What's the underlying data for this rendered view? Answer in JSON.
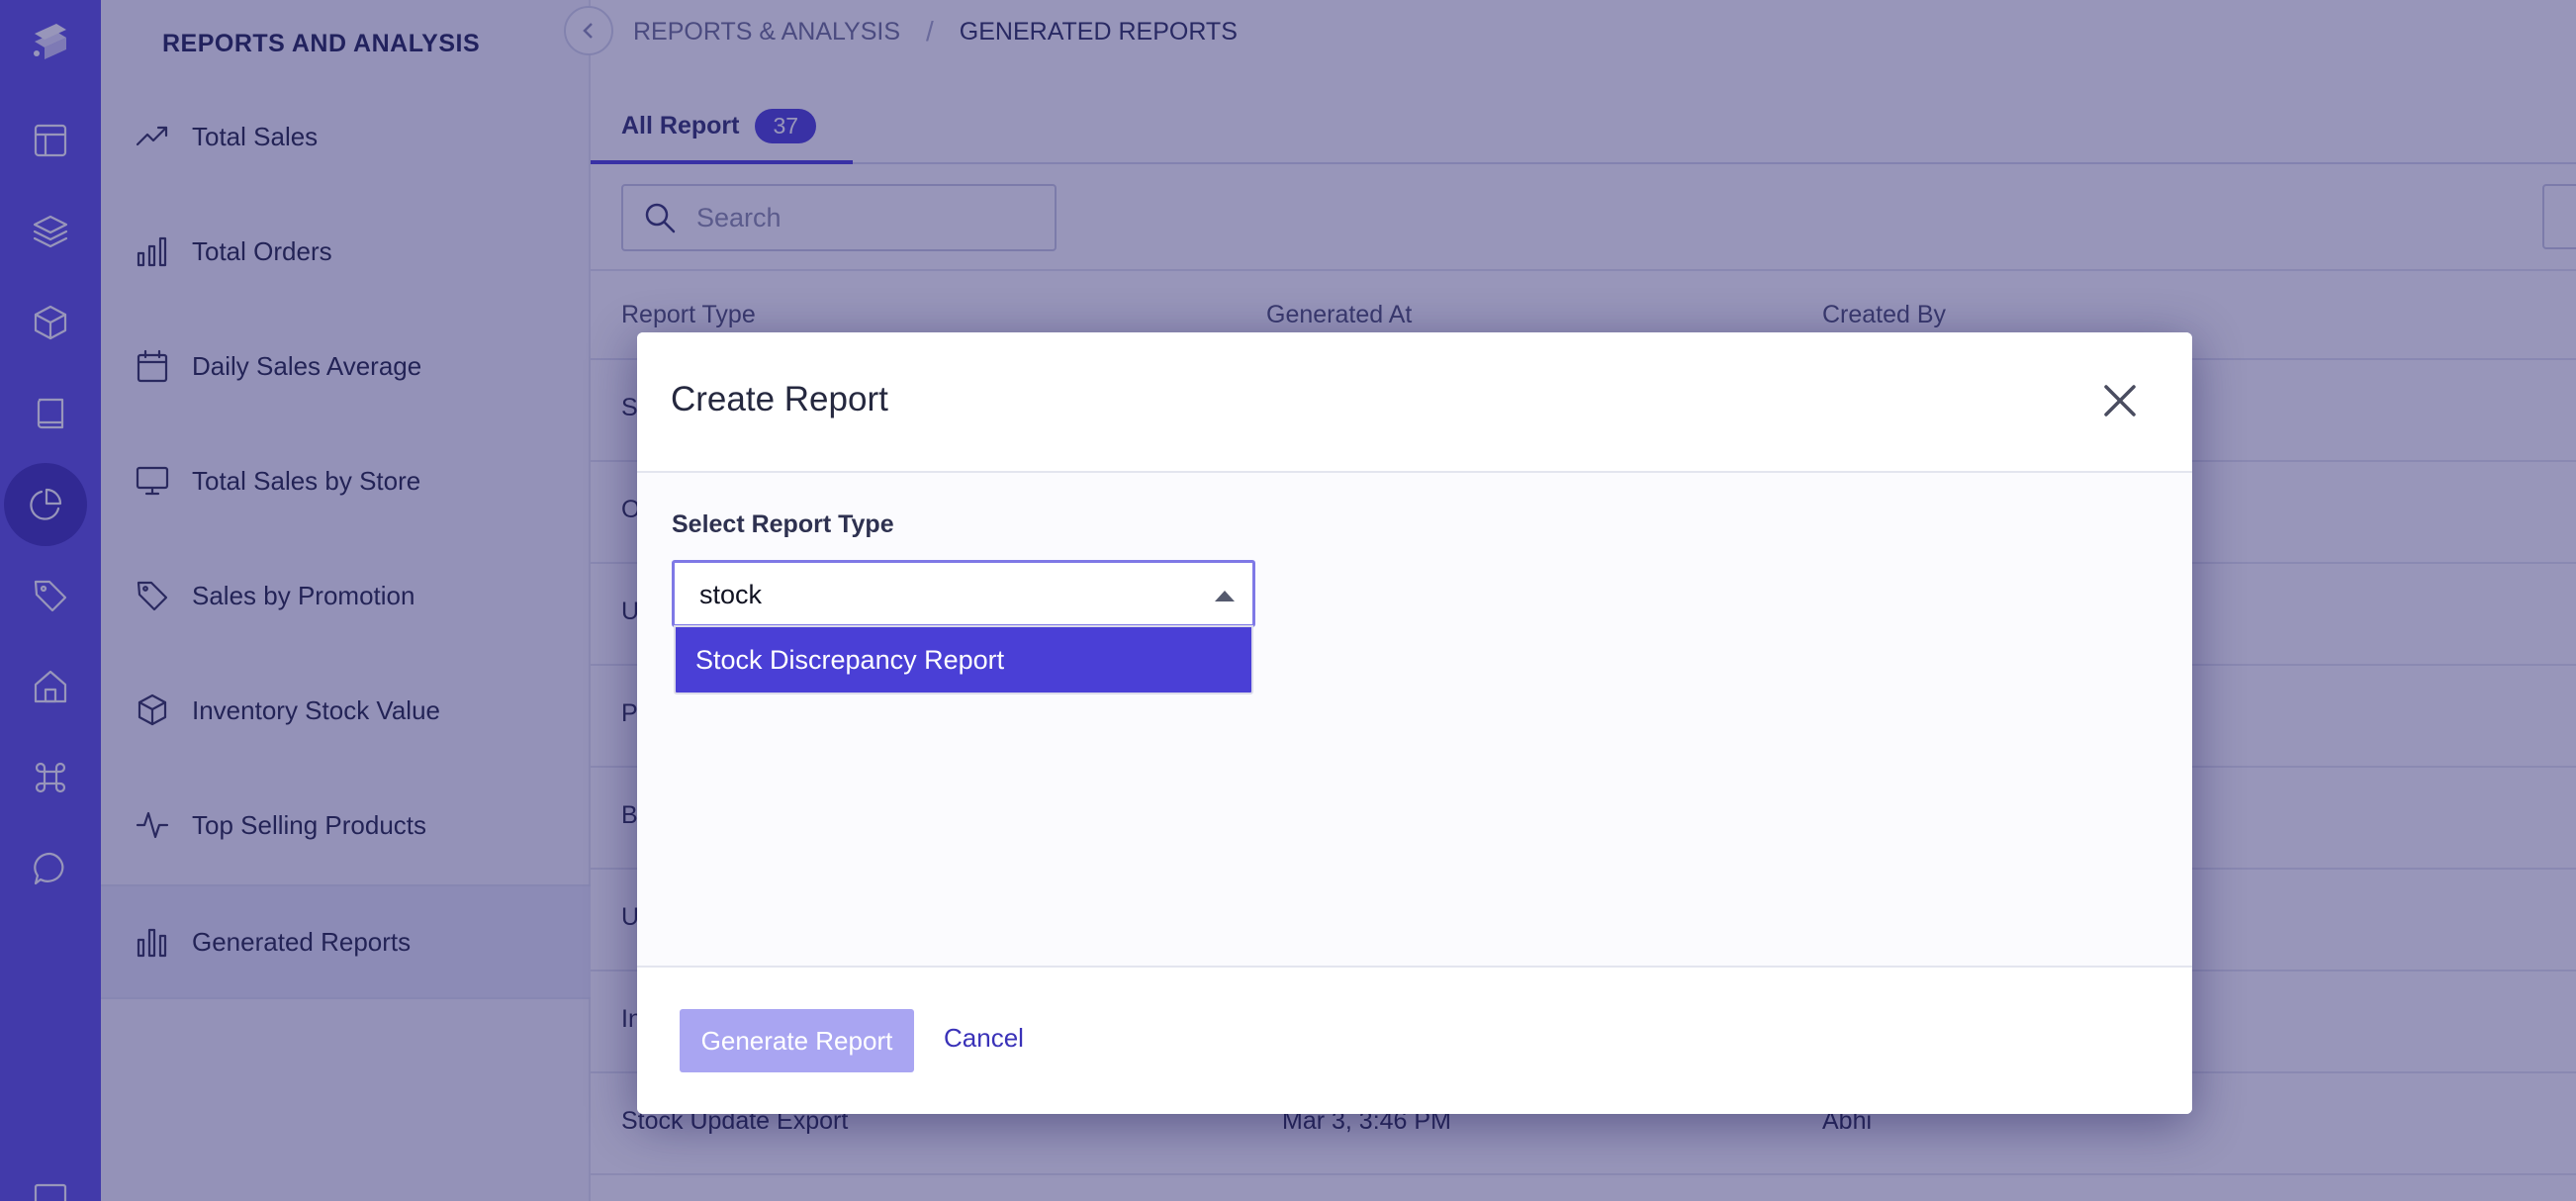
{
  "rail": {
    "icons": [
      "logo-icon",
      "layout-icon",
      "layers-icon",
      "box-icon",
      "book-icon",
      "pie-chart-icon",
      "tag-icon",
      "home-icon",
      "command-icon",
      "chat-icon",
      "monitor-icon"
    ],
    "active": "pie-chart-icon"
  },
  "sidebar": {
    "title": "REPORTS AND ANALYSIS",
    "items": [
      {
        "label": "Total Sales",
        "icon": "trending-up-icon"
      },
      {
        "label": "Total Orders",
        "icon": "bar-chart-icon"
      },
      {
        "label": "Daily Sales Average",
        "icon": "calendar-icon"
      },
      {
        "label": "Total Sales by Store",
        "icon": "monitor-icon"
      },
      {
        "label": "Sales by Promotion",
        "icon": "tag-icon"
      },
      {
        "label": "Inventory Stock Value",
        "icon": "box-icon"
      },
      {
        "label": "Top Selling Products",
        "icon": "activity-icon"
      },
      {
        "label": "Generated Reports",
        "icon": "bar-chart-icon",
        "active": true
      }
    ]
  },
  "breadcrumb": {
    "parent": "REPORTS & ANALYSIS",
    "separator": "/",
    "current": "GENERATED REPORTS"
  },
  "tabs": {
    "all_label": "All Report",
    "all_count": "37"
  },
  "search": {
    "placeholder": "Search"
  },
  "table": {
    "columns": [
      "Report Type",
      "Generated At",
      "Created By"
    ],
    "rows": [
      {
        "type": "S",
        "generated": "",
        "created": ""
      },
      {
        "type": "O",
        "generated": "",
        "created": ""
      },
      {
        "type": "U",
        "generated": "",
        "created": ""
      },
      {
        "type": "P",
        "generated": "",
        "created": ""
      },
      {
        "type": "B",
        "generated": "",
        "created": ""
      },
      {
        "type": "U",
        "generated": "",
        "created": ""
      },
      {
        "type": "In",
        "generated": "",
        "created": ""
      },
      {
        "type": "Stock Update Export",
        "generated": "Mar 3, 3:46 PM",
        "created": "Abhi"
      }
    ]
  },
  "modal": {
    "title": "Create Report",
    "field_label": "Select Report Type",
    "input_value": "stock",
    "options": [
      "Stock Discrepancy Report"
    ],
    "generate_label": "Generate Report",
    "cancel_label": "Cancel"
  },
  "colors": {
    "accent": "#4a3fd6",
    "rail": "#5a4fe0",
    "generate_disabled": "#a9a5f2"
  }
}
